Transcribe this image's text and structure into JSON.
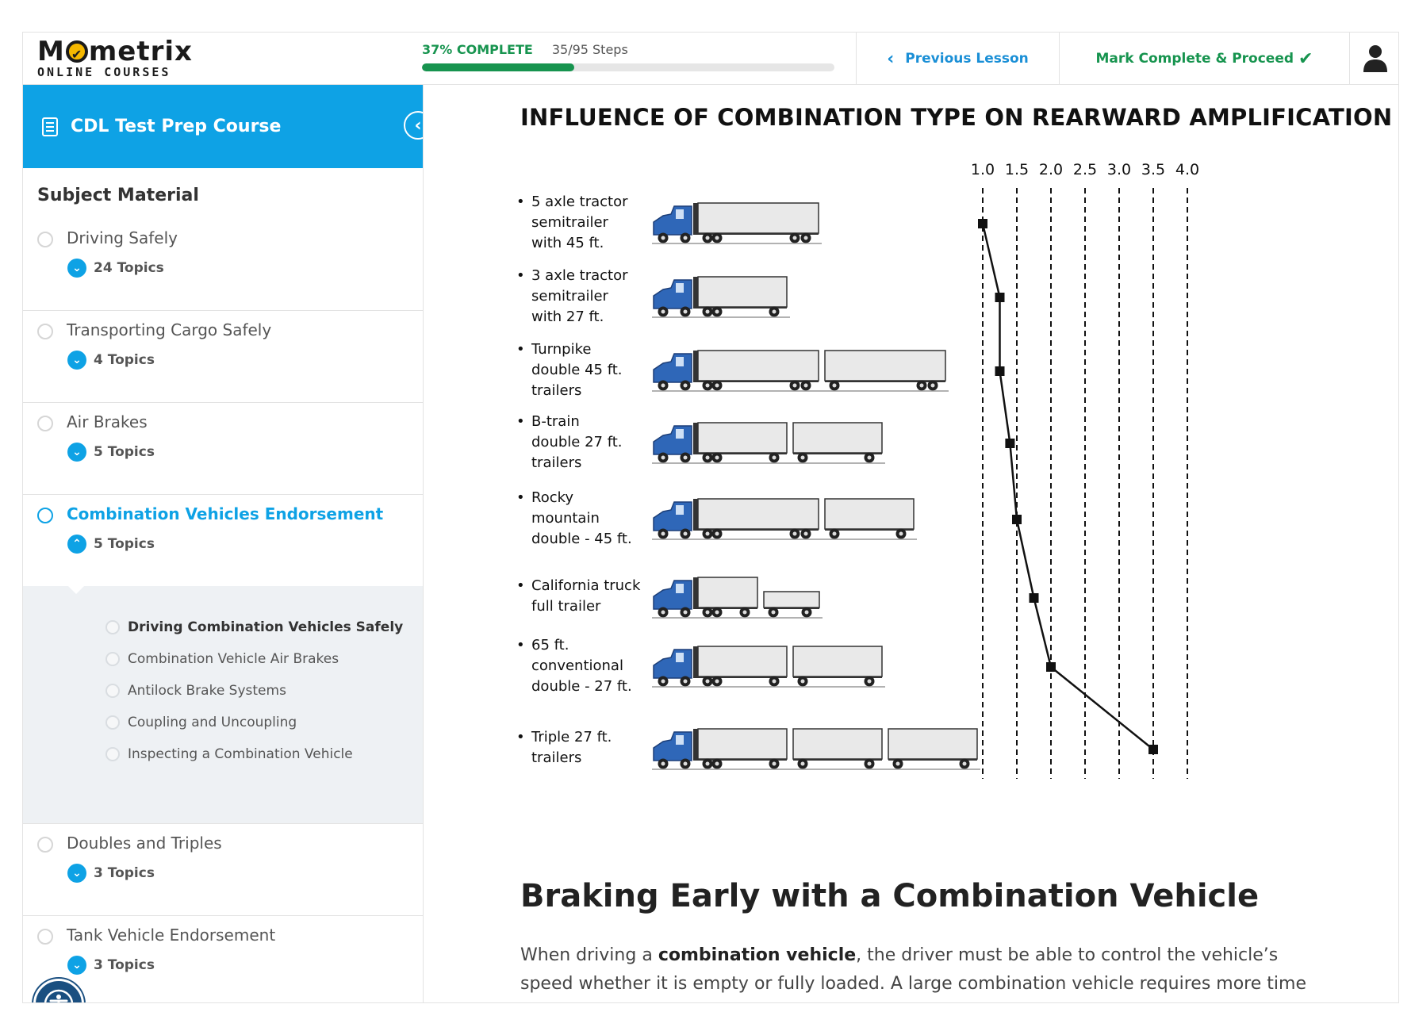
{
  "brand": {
    "name_pre": "M",
    "name_post": "metrix",
    "tagline": "ONLINE COURSES"
  },
  "progress": {
    "percent_label": "37% COMPLETE",
    "steps_label": "35/95 Steps",
    "fraction": 0.37
  },
  "nav": {
    "previous_label": "Previous Lesson",
    "mark_complete_label": "Mark Complete & Proceed"
  },
  "sidebar": {
    "course_title": "CDL Test Prep Course",
    "subject_heading": "Subject Material",
    "sections": [
      {
        "name": "Driving Safely",
        "topics": "24 Topics"
      },
      {
        "name": "Transporting Cargo Safely",
        "topics": "4 Topics"
      },
      {
        "name": "Air Brakes",
        "topics": "5 Topics"
      },
      {
        "name": "Combination Vehicles Endorsement",
        "topics": "5 Topics"
      },
      {
        "name": "Doubles and Triples",
        "topics": "3 Topics"
      },
      {
        "name": "Tank Vehicle Endorsement",
        "topics": "3 Topics"
      }
    ],
    "subtopics": [
      "Driving Combination Vehicles Safely",
      "Combination Vehicle Air Brakes",
      "Antilock Brake Systems",
      "Coupling and Uncoupling",
      "Inspecting a Combination Vehicle"
    ]
  },
  "chart_data": {
    "type": "line",
    "title": "INFLUENCE OF COMBINATION TYPE ON REARWARD AMPLIFICATION",
    "x_ticks": [
      "1.0",
      "1.5",
      "2.0",
      "2.5",
      "3.0",
      "3.5",
      "4.0"
    ],
    "xlim": [
      1.0,
      4.0
    ],
    "categories": [
      [
        "5 axle tractor",
        "semitrailer",
        "with 45 ft."
      ],
      [
        "3 axle tractor",
        "semitrailer",
        "with 27 ft."
      ],
      [
        "Turnpike",
        "double 45 ft.",
        "trailers"
      ],
      [
        "B-train",
        "double 27 ft.",
        "trailers"
      ],
      [
        "Rocky",
        "mountain",
        "double - 45 ft."
      ],
      [
        "California truck",
        "full trailer"
      ],
      [
        "65 ft.",
        "conventional",
        "double - 27 ft."
      ],
      [
        "Triple 27 ft.",
        "trailers"
      ]
    ],
    "values": [
      1.0,
      1.25,
      1.25,
      1.4,
      1.5,
      1.75,
      2.0,
      3.5
    ]
  },
  "content": {
    "heading": "Braking Early with a Combination Vehicle",
    "para_pre": "When driving a ",
    "para_bold": "combination vehicle",
    "para_post": ", the driver must be able to control the vehicle’s speed whether it is empty or fully loaded. A large combination vehicle requires more time"
  },
  "colors": {
    "accent": "#0ea2e5",
    "success": "#17944f",
    "cab": "#2f67b8"
  }
}
